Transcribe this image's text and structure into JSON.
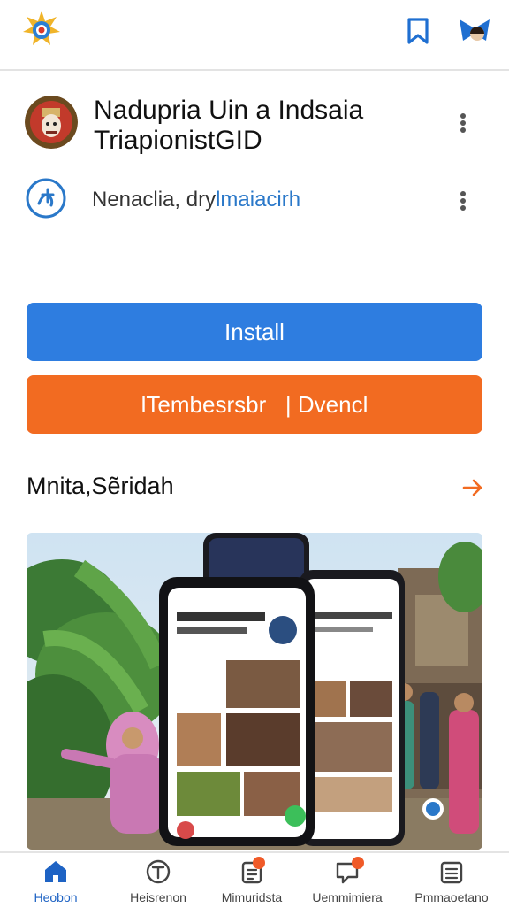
{
  "header": {
    "logo_icon": "emblem-icon",
    "bookmark_icon": "bookmark-icon",
    "avatar_icon": "profile-avatar"
  },
  "app": {
    "title_line1": "Nadupria Uin a Indsaia",
    "title_line2": "TriapionistGID",
    "developer_prefix": "Nenaclia, dry",
    "developer_accent": "lmaiacirh"
  },
  "buttons": {
    "install": "Install",
    "secondary": "lTembesrsbr   | Dvencl"
  },
  "section": {
    "title": "Mnita,Sẽridah"
  },
  "nav": {
    "items": [
      {
        "label": "Heobon",
        "icon": "home-icon"
      },
      {
        "label": "Heisrenon",
        "icon": "explore-icon"
      },
      {
        "label": "Mimuridsta",
        "icon": "notes-icon"
      },
      {
        "label": "Uemmimiera",
        "icon": "message-icon"
      },
      {
        "label": "Pmmaoetano",
        "icon": "list-icon"
      }
    ]
  },
  "colors": {
    "install": "#2e7de0",
    "secondary": "#f26b21",
    "accent": "#2a78c9",
    "nav_active": "#1e63c4"
  }
}
